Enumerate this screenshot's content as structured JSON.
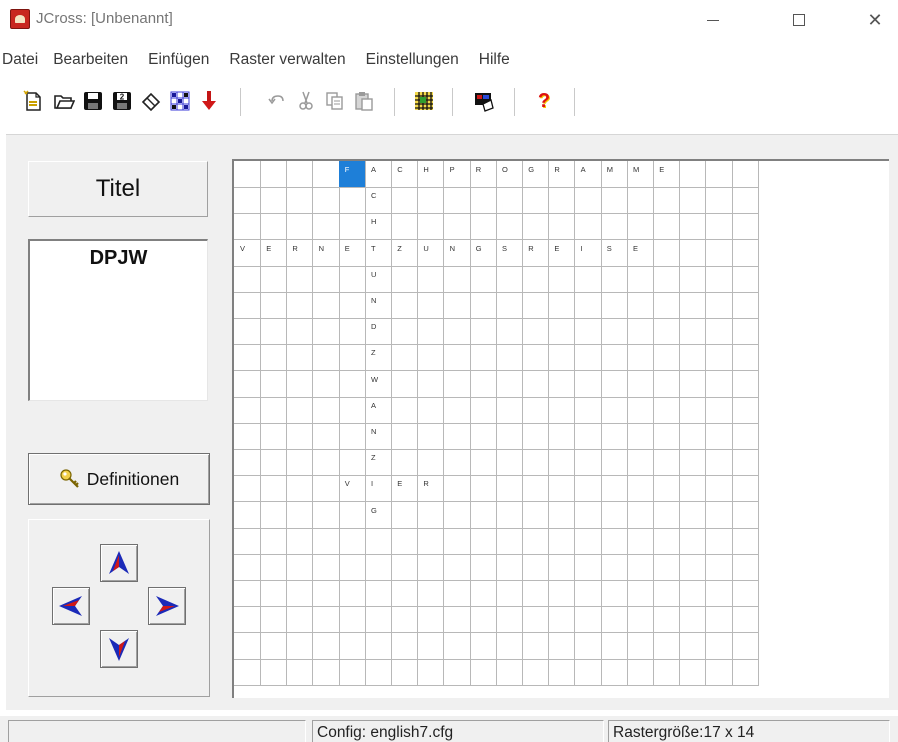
{
  "window": {
    "title": "JCross: [Unbenannt]",
    "controls": {
      "minimize": "minimize-icon",
      "maximize": "maximize-icon",
      "close_glyph": "✕"
    }
  },
  "menu": {
    "items": [
      "Datei",
      "Bearbeiten",
      "Einfügen",
      "Raster verwalten",
      "Einstellungen",
      "Hilfe"
    ]
  },
  "toolbar": {
    "buttons": [
      {
        "icon": "new-file-icon",
        "enabled": true
      },
      {
        "icon": "open-folder-icon",
        "enabled": true
      },
      {
        "icon": "save-icon",
        "enabled": true
      },
      {
        "icon": "save-as-icon",
        "enabled": true
      },
      {
        "icon": "eraser-icon",
        "enabled": true
      },
      {
        "icon": "random-fill-icon",
        "enabled": true
      },
      {
        "icon": "export-arrow-icon",
        "enabled": true
      },
      {
        "icon": "undo-icon",
        "enabled": false
      },
      {
        "icon": "cut-icon",
        "enabled": false
      },
      {
        "icon": "copy-icon",
        "enabled": false
      },
      {
        "icon": "paste-icon",
        "enabled": false
      },
      {
        "icon": "grid-icon",
        "enabled": true
      },
      {
        "icon": "web-export-icon",
        "enabled": true
      },
      {
        "icon": "help-icon",
        "enabled": true
      }
    ],
    "help_glyph": "?"
  },
  "left_panel": {
    "title_label": "Titel",
    "name_value": "DPJW",
    "definitions_label": "Definitionen",
    "nav_icons": [
      "arrow-up-icon",
      "arrow-left-icon",
      "arrow-right-icon",
      "arrow-down-icon"
    ]
  },
  "grid": {
    "cols": 20,
    "rows": 20,
    "active_row": 0,
    "active_col": 4,
    "rows_data": [
      "    FACHPROGRAMME    ",
      "     C              ",
      "     H              ",
      "VERNETZUNGSREISE    ",
      "     U              ",
      "     N              ",
      "     D              ",
      "     Z              ",
      "     W              ",
      "     A              ",
      "     N              ",
      "     Z              ",
      "    VIER            ",
      "     G              ",
      "                    ",
      "                    ",
      "                    ",
      "                    ",
      "                    ",
      "                    "
    ]
  },
  "status": {
    "left": "",
    "config": "Config: english7.cfg",
    "size": "Rastergröße:17 x 14"
  },
  "colors": {
    "panel": "#f0f0f0",
    "active_cell": "#1e7fd8",
    "arrow_blue": "#1b2ab8",
    "arrow_red": "#d01818"
  }
}
